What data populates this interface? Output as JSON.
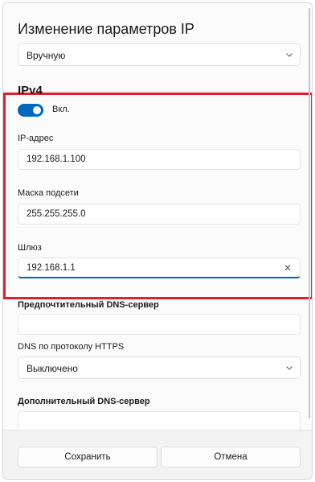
{
  "dialog": {
    "title": "Изменение параметров IP",
    "mode_select": {
      "value": "Вручную",
      "icon": "chevron-down-icon"
    }
  },
  "ipv4": {
    "section_title": "IPv4",
    "toggle": {
      "state": "on",
      "label": "Вкл."
    },
    "ip_address": {
      "label": "IP-адрес",
      "value": "192.168.1.100"
    },
    "subnet_mask": {
      "label": "Маска подсети",
      "value": "255.255.255.0"
    },
    "gateway": {
      "label": "Шлюз",
      "value": "192.168.1.1",
      "clear_icon": "✕"
    }
  },
  "dns": {
    "preferred": {
      "label": "Предпочтительный DNS-сервер",
      "value": ""
    },
    "https": {
      "label": "DNS по протоколу HTTPS",
      "value": "Выключено",
      "icon": "chevron-down-icon"
    },
    "alternate": {
      "label": "Дополнительный DNS-сервер",
      "value": ""
    }
  },
  "footer": {
    "save_label": "Сохранить",
    "cancel_label": "Отмена"
  },
  "colors": {
    "accent": "#0067c0",
    "highlight": "#e0202e"
  }
}
